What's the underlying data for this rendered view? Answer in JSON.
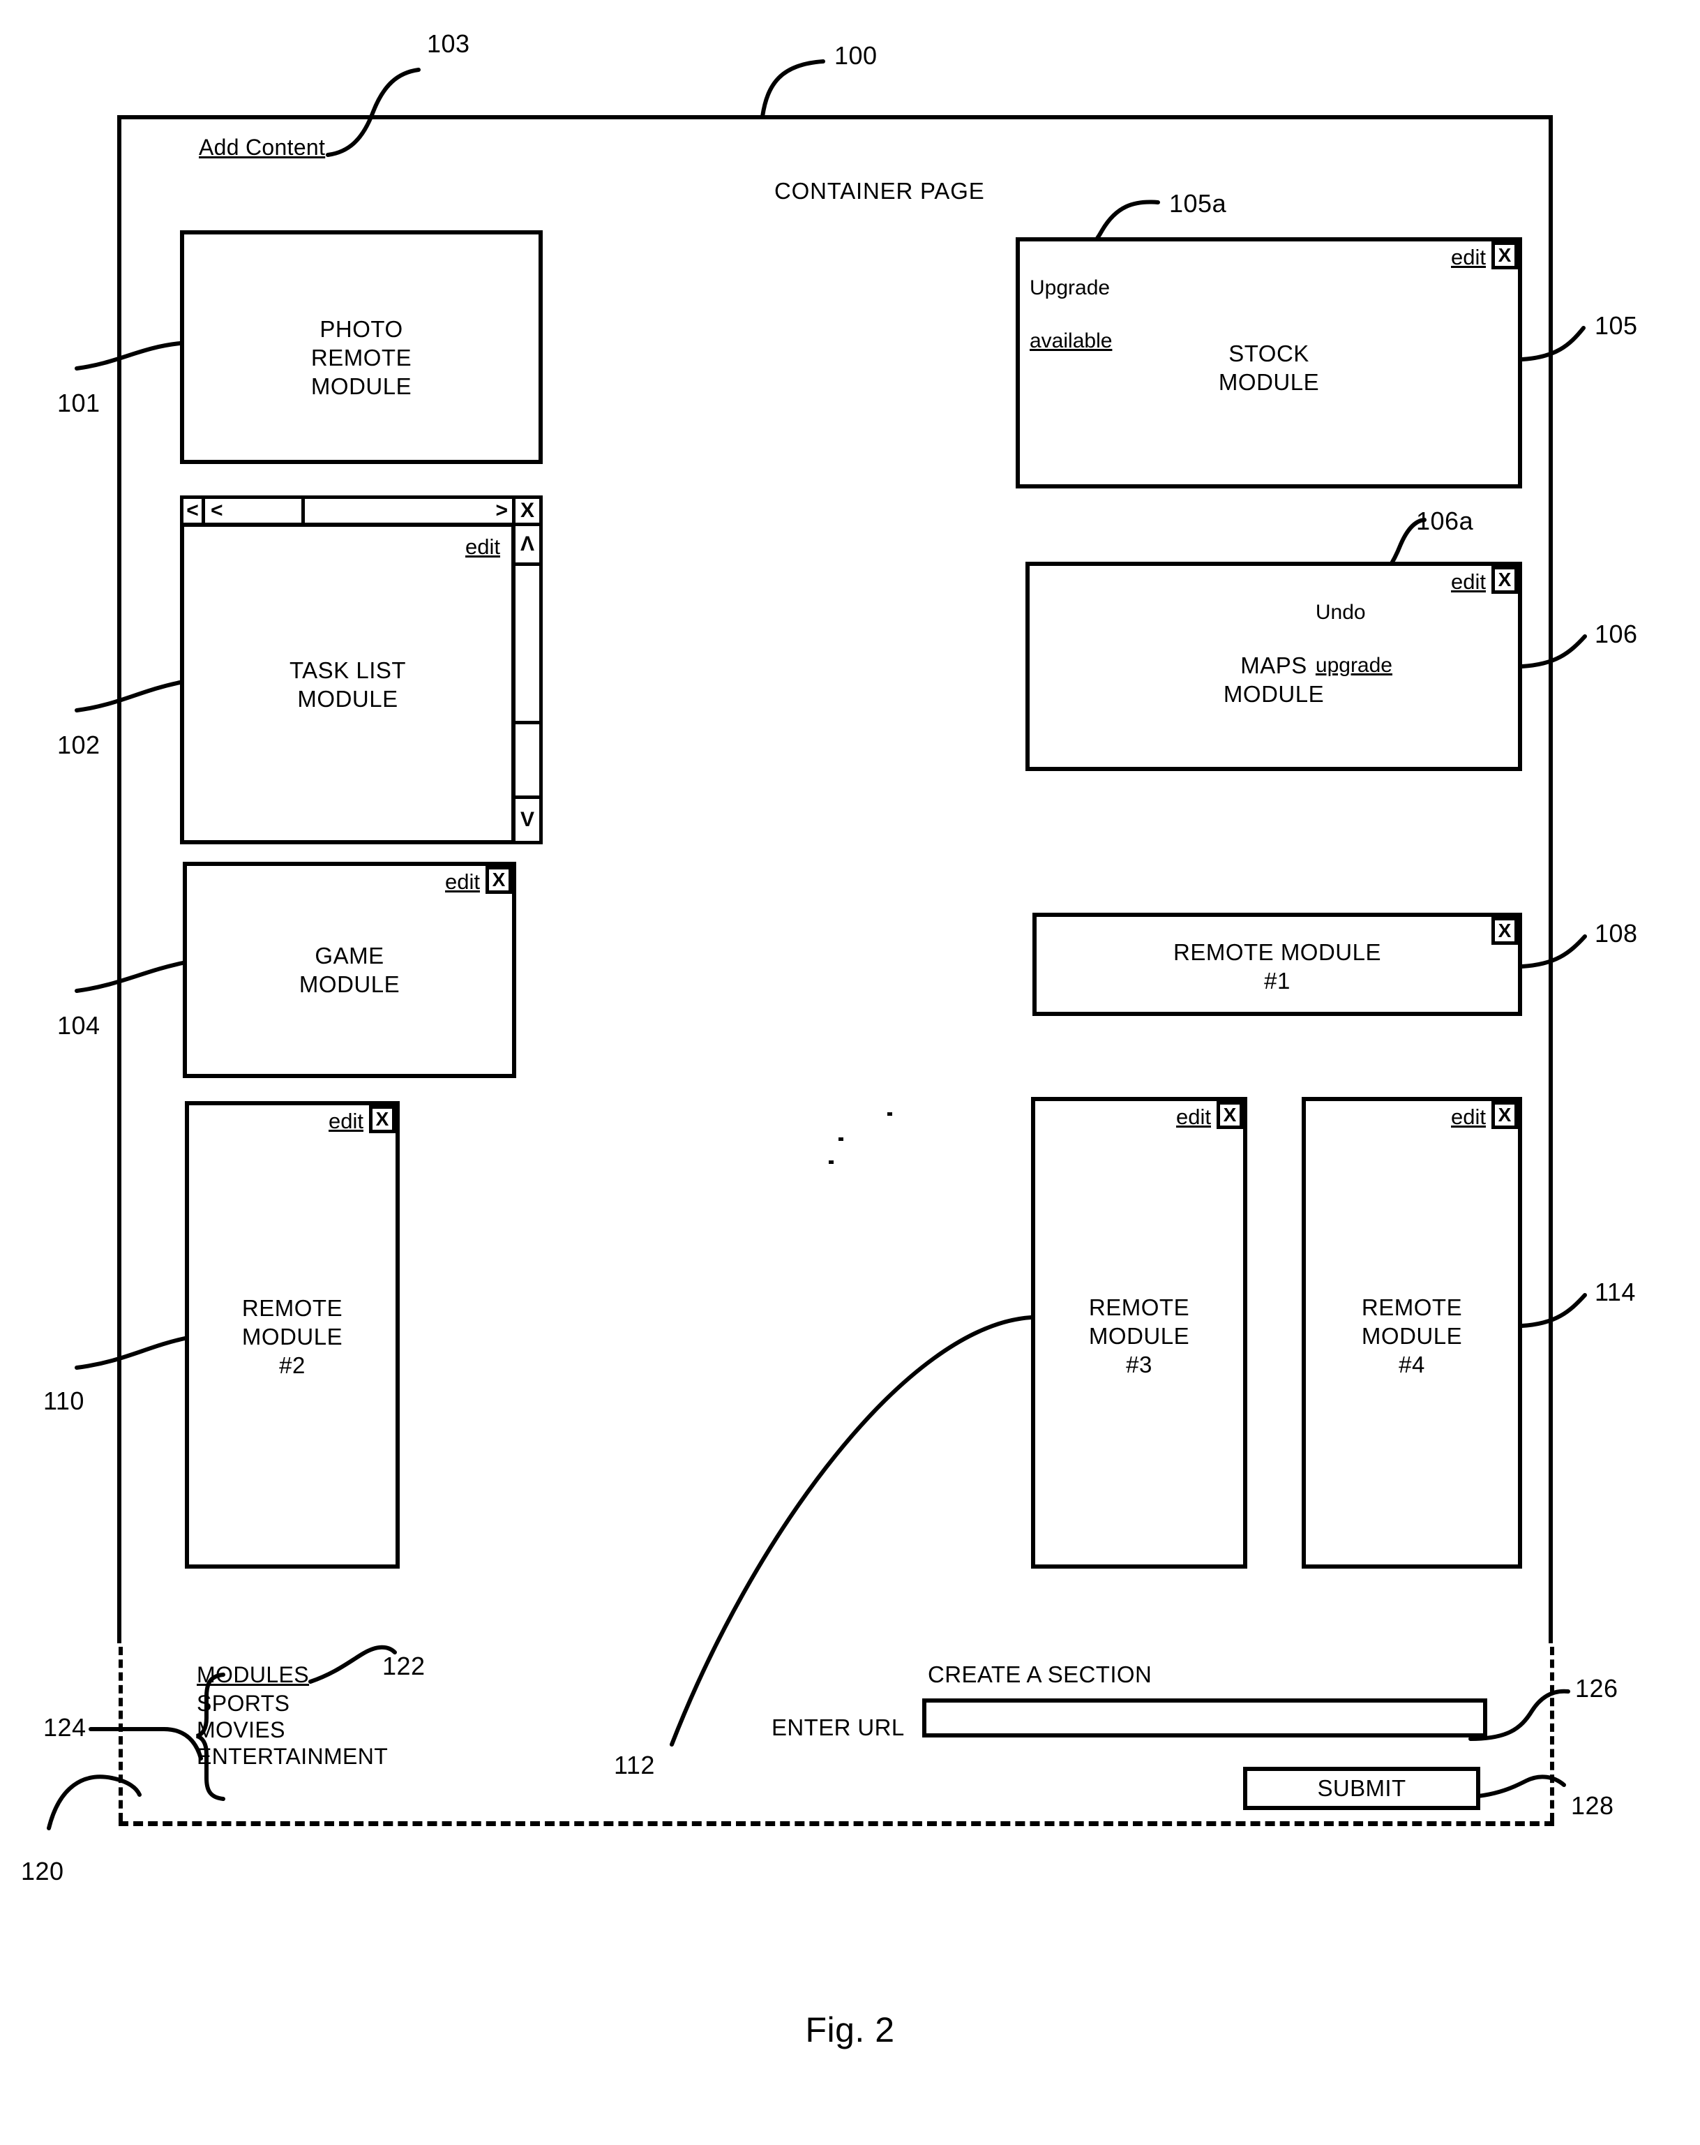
{
  "figure": {
    "caption": "Fig. 2",
    "container_label": "CONTAINER PAGE",
    "add_content_link": "Add Content"
  },
  "refs": {
    "r100": "100",
    "r103": "103",
    "r101": "101",
    "r102": "102",
    "r104": "104",
    "r105": "105",
    "r105a": "105a",
    "r106": "106",
    "r106a": "106a",
    "r108": "108",
    "r110": "110",
    "r112": "112",
    "r114": "114",
    "r120": "120",
    "r122": "122",
    "r124": "124",
    "r126": "126",
    "r128": "128"
  },
  "controls": {
    "edit_label": "edit",
    "close_label": "X",
    "scroll_left": "<",
    "scroll_thumb_left": "<",
    "scroll_right": ">",
    "scroll_up": "Λ",
    "scroll_down": "V"
  },
  "modules": {
    "photo": {
      "title": "PHOTO\nREMOTE\nMODULE",
      "has_edit": false,
      "has_close": false
    },
    "task_list": {
      "title": "TASK LIST\nMODULE",
      "has_edit": true,
      "has_close": true
    },
    "game": {
      "title": "GAME\nMODULE",
      "has_edit": true,
      "has_close": true
    },
    "remote2": {
      "title": "REMOTE\nMODULE\n#2",
      "has_edit": true,
      "has_close": true
    },
    "stock": {
      "title": "STOCK\nMODULE",
      "notice": "Upgrade\navailable",
      "notice_line1": "Upgrade",
      "notice_line2": "available",
      "has_edit": true,
      "has_close": true
    },
    "maps": {
      "title": "MAPS\nMODULE",
      "notice_line1": "Undo",
      "notice_line2": "upgrade",
      "has_edit": true,
      "has_close": true
    },
    "remote1": {
      "title": "REMOTE MODULE\n#1",
      "has_edit": false,
      "has_close": true
    },
    "remote3": {
      "title": "REMOTE\nMODULE\n#3",
      "has_edit": true,
      "has_close": true
    },
    "remote4": {
      "title": "REMOTE\nMODULE\n#4",
      "has_edit": true,
      "has_close": true
    }
  },
  "bottom": {
    "modules_heading": "MODULES",
    "modules_items": [
      "SPORTS",
      "MOVIES",
      "ENTERTAINMENT"
    ],
    "create_section_title": "CREATE A SECTION",
    "url_label": "ENTER URL",
    "url_value": "",
    "url_placeholder": "",
    "submit_label": "SUBMIT"
  }
}
